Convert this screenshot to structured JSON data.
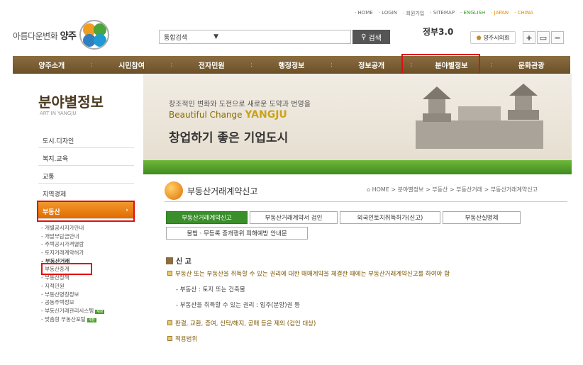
{
  "topnav": {
    "home": "· HOME",
    "login": "· LOGIN",
    "join": "· 회원가입",
    "sitemap": "· SITEMAP",
    "english": "· ENGLISH",
    "japan": "· JAPAN",
    "china": "· CHINA"
  },
  "logo": {
    "tagline": "아름다운변화",
    "city": "양주"
  },
  "search": {
    "scope": "통합검색",
    "button": "검색"
  },
  "gov": {
    "small": "정부 3.0",
    "label": "정부3.0"
  },
  "council": "양주시의회",
  "tools": {
    "zoom_in": "+",
    "monitor": "▭",
    "zoom_out": "−"
  },
  "mainnav": [
    "양주소개",
    "시민참여",
    "전자민원",
    "행정정보",
    "정보공개",
    "분야별정보",
    "문화관광"
  ],
  "sidebar": {
    "title": "분야별정보",
    "subtitle": "ART IN YANGJU",
    "items": [
      "도시.디자인",
      "복지.교육",
      "교통",
      "지역경제",
      "부동산"
    ],
    "sub_items": [
      "개별공시지가안내",
      "개발부담금안내",
      "주택공시가격열람",
      "토지거래계약허가",
      "부동산거래",
      "부동산중개",
      "부동산정책",
      "지적민원",
      "부동산명칭정보",
      "공동주택정보",
      "부동산거래관리시스템",
      "맞춤형 부동산포털"
    ],
    "new_badge": "새창"
  },
  "banner": {
    "line1": "창조적인 변화와 도전으로 새로운 도약과 번영을",
    "line2": "Beautiful Change",
    "line2b": "YANGJU",
    "line3": "창업하기 좋은 기업도시"
  },
  "content": {
    "title": "부동산거래계약신고",
    "breadcrumb": "⌂ HOME > 분야별정보 > 부동산 > 부동산거래 > 부동산거래계약신고",
    "tabs": [
      "부동산거래계약신고",
      "부동산거래계약서 검인",
      "외국인토지취득허가(신고)",
      "부동산실명제",
      "불법 · 무등록 중개행위 피해예방 안내문"
    ],
    "section1": "신 고",
    "p1": "부동산 또는 부동산을 취득할 수 있는 권리에 대한 매매계약을 체결한 때에는 부동산거래계약신고를 하여야 함",
    "p2": "- 부동산 : 토지 또는 건축물",
    "p3": "- 부동산을 취득할 수 있는 권리 : 입주(분양)권 등",
    "p4": "판결, 교환, 증여, 신탁/해지, 공매 등은 제외 (검인 대상)",
    "section2": "적용범위"
  }
}
